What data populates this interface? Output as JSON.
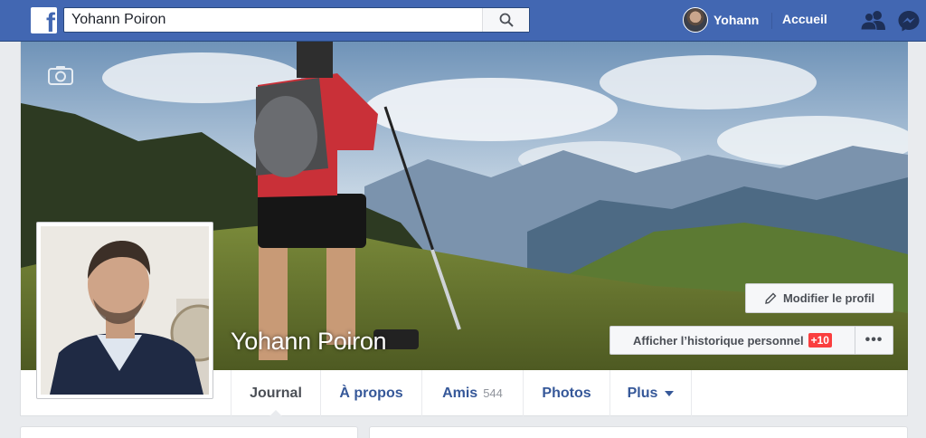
{
  "header": {
    "search_value": "Yohann Poiron",
    "user_name": "Yohann",
    "home_label": "Accueil",
    "icons": [
      "facebook-logo-icon",
      "search-icon",
      "friend-requests-icon",
      "messenger-icon"
    ],
    "brand_color": "#4267b2"
  },
  "profile": {
    "name": "Yohann Poiron",
    "edit_profile_label": "Modifier le profil",
    "history_label": "Afficher l’historique personnel",
    "history_badge": "+10",
    "more_label": "•••"
  },
  "tabs": [
    {
      "label": "Journal",
      "active": true
    },
    {
      "label": "À propos"
    },
    {
      "label": "Amis",
      "count": "544"
    },
    {
      "label": "Photos"
    },
    {
      "label": "Plus"
    }
  ]
}
